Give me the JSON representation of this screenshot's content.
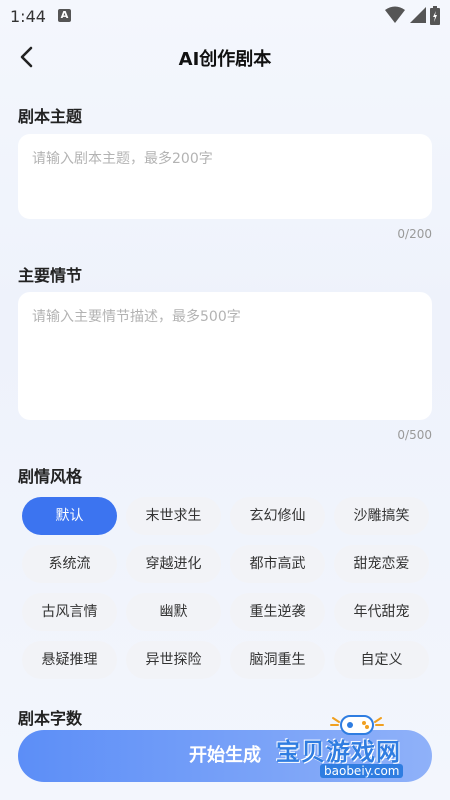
{
  "status": {
    "time": "1:44",
    "notification_badge": "A"
  },
  "header": {
    "title": "AI创作剧本"
  },
  "theme": {
    "label": "剧本主题",
    "placeholder": "请输入剧本主题，最多200字",
    "counter": "0/200"
  },
  "plot": {
    "label": "主要情节",
    "placeholder": "请输入主要情节描述，最多500字",
    "counter": "0/500"
  },
  "style": {
    "label": "剧情风格",
    "selected": "默认",
    "options": [
      "默认",
      "末世求生",
      "玄幻修仙",
      "沙雕搞笑",
      "系统流",
      "穿越进化",
      "都市高武",
      "甜宠恋爱",
      "古风言情",
      "幽默",
      "重生逆袭",
      "年代甜宠",
      "悬疑推理",
      "异世探险",
      "脑洞重生",
      "自定义"
    ]
  },
  "word_count": {
    "label": "剧本字数"
  },
  "generate": {
    "label": "开始生成"
  },
  "watermark": {
    "title": "宝贝游戏网",
    "url": "baobeiy.com"
  },
  "colors": {
    "accent": "#3c74f0",
    "button_start": "#5c8ef7",
    "button_end": "#8fb1f9",
    "chip_bg": "#f2f3f7"
  }
}
